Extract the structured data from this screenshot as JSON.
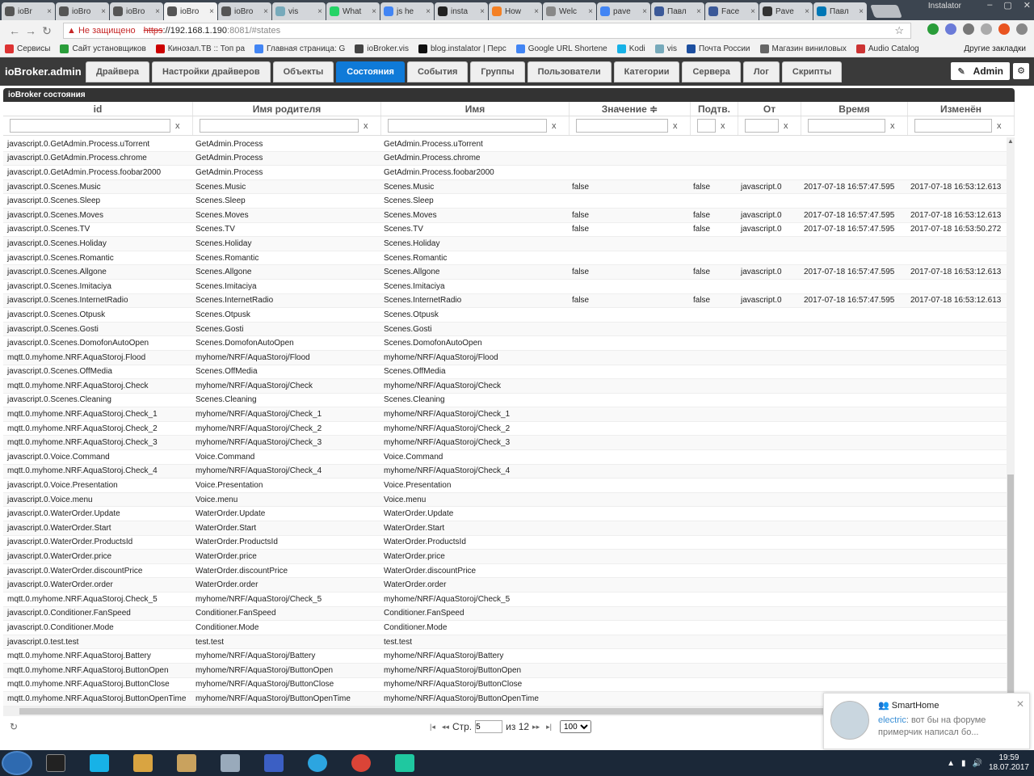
{
  "browser": {
    "tabs": [
      {
        "label": "ioBr",
        "color": "#555"
      },
      {
        "label": "ioBro",
        "color": "#555"
      },
      {
        "label": "ioBro",
        "color": "#555"
      },
      {
        "label": "ioBro",
        "color": "#555"
      },
      {
        "label": "ioBro",
        "color": "#555"
      },
      {
        "label": "vis",
        "color": "#7ab"
      },
      {
        "label": "What",
        "color": "#25d366"
      },
      {
        "label": "js he",
        "color": "#4285f4"
      },
      {
        "label": "insta",
        "color": "#222"
      },
      {
        "label": "How",
        "color": "#f48024"
      },
      {
        "label": "Welc",
        "color": "#888"
      },
      {
        "label": "pave",
        "color": "#4285f4"
      },
      {
        "label": "Павл",
        "color": "#3b5998"
      },
      {
        "label": "Face",
        "color": "#3b5998"
      },
      {
        "label": "Pave",
        "color": "#333"
      },
      {
        "label": "Павл",
        "color": "#0077b5"
      }
    ],
    "user": "Instalator",
    "insecure_label": "Не защищено",
    "url_scheme": "https",
    "url_host": "://192.168.1.190",
    "url_rest": ":8081/#states",
    "bookmarks": [
      "Сервисы",
      "Сайт установщиков",
      "Кинозал.ТВ :: Топ ра",
      "Главная страница: G",
      "ioBroker.vis",
      "blog.instalator | Перс",
      "Google URL Shortene",
      "Kodi",
      "vis",
      "Почта России",
      "Магазин виниловых",
      "Audio Catalog"
    ],
    "other_bookmarks": "Другие закладки"
  },
  "app": {
    "brand": "ioBroker.admin",
    "tabs": [
      "Драйвера",
      "Настройки драйверов",
      "Объекты",
      "Состояния",
      "События",
      "Группы",
      "Пользователи",
      "Категории",
      "Сервера",
      "Лог",
      "Скрипты"
    ],
    "active_tab": "Состояния",
    "user": "Admin",
    "accent": "#0f7ad8"
  },
  "grid": {
    "caption": "ioBroker состояния",
    "columns": [
      "id",
      "Имя родителя",
      "Имя",
      "Значение ≑",
      "Подтв.",
      "От",
      "Время",
      "Изменён"
    ],
    "filter_clear": "x",
    "rows": [
      [
        "javascript.0.GetAdmin.Process.uTorrent",
        "GetAdmin.Process",
        "GetAdmin.Process.uTorrent",
        "",
        "",
        "",
        "",
        ""
      ],
      [
        "javascript.0.GetAdmin.Process.chrome",
        "GetAdmin.Process",
        "GetAdmin.Process.chrome",
        "",
        "",
        "",
        "",
        ""
      ],
      [
        "javascript.0.GetAdmin.Process.foobar2000",
        "GetAdmin.Process",
        "GetAdmin.Process.foobar2000",
        "",
        "",
        "",
        "",
        ""
      ],
      [
        "javascript.0.Scenes.Music",
        "Scenes.Music",
        "Scenes.Music",
        "false",
        "false",
        "javascript.0",
        "2017-07-18 16:57:47.595",
        "2017-07-18 16:53:12.613"
      ],
      [
        "javascript.0.Scenes.Sleep",
        "Scenes.Sleep",
        "Scenes.Sleep",
        "",
        "",
        "",
        "",
        ""
      ],
      [
        "javascript.0.Scenes.Moves",
        "Scenes.Moves",
        "Scenes.Moves",
        "false",
        "false",
        "javascript.0",
        "2017-07-18 16:57:47.595",
        "2017-07-18 16:53:12.613"
      ],
      [
        "javascript.0.Scenes.TV",
        "Scenes.TV",
        "Scenes.TV",
        "false",
        "false",
        "javascript.0",
        "2017-07-18 16:57:47.595",
        "2017-07-18 16:53:50.272"
      ],
      [
        "javascript.0.Scenes.Holiday",
        "Scenes.Holiday",
        "Scenes.Holiday",
        "",
        "",
        "",
        "",
        ""
      ],
      [
        "javascript.0.Scenes.Romantic",
        "Scenes.Romantic",
        "Scenes.Romantic",
        "",
        "",
        "",
        "",
        ""
      ],
      [
        "javascript.0.Scenes.Allgone",
        "Scenes.Allgone",
        "Scenes.Allgone",
        "false",
        "false",
        "javascript.0",
        "2017-07-18 16:57:47.595",
        "2017-07-18 16:53:12.613"
      ],
      [
        "javascript.0.Scenes.Imitaciya",
        "Scenes.Imitaciya",
        "Scenes.Imitaciya",
        "",
        "",
        "",
        "",
        ""
      ],
      [
        "javascript.0.Scenes.InternetRadio",
        "Scenes.InternetRadio",
        "Scenes.InternetRadio",
        "false",
        "false",
        "javascript.0",
        "2017-07-18 16:57:47.595",
        "2017-07-18 16:53:12.613"
      ],
      [
        "javascript.0.Scenes.Otpusk",
        "Scenes.Otpusk",
        "Scenes.Otpusk",
        "",
        "",
        "",
        "",
        ""
      ],
      [
        "javascript.0.Scenes.Gosti",
        "Scenes.Gosti",
        "Scenes.Gosti",
        "",
        "",
        "",
        "",
        ""
      ],
      [
        "javascript.0.Scenes.DomofonAutoOpen",
        "Scenes.DomofonAutoOpen",
        "Scenes.DomofonAutoOpen",
        "",
        "",
        "",
        "",
        ""
      ],
      [
        "mqtt.0.myhome.NRF.AquaStoroj.Flood",
        "myhome/NRF/AquaStoroj/Flood",
        "myhome/NRF/AquaStoroj/Flood",
        "",
        "",
        "",
        "",
        ""
      ],
      [
        "javascript.0.Scenes.OffMedia",
        "Scenes.OffMedia",
        "Scenes.OffMedia",
        "",
        "",
        "",
        "",
        ""
      ],
      [
        "mqtt.0.myhome.NRF.AquaStoroj.Check",
        "myhome/NRF/AquaStoroj/Check",
        "myhome/NRF/AquaStoroj/Check",
        "",
        "",
        "",
        "",
        ""
      ],
      [
        "javascript.0.Scenes.Cleaning",
        "Scenes.Cleaning",
        "Scenes.Cleaning",
        "",
        "",
        "",
        "",
        ""
      ],
      [
        "mqtt.0.myhome.NRF.AquaStoroj.Check_1",
        "myhome/NRF/AquaStoroj/Check_1",
        "myhome/NRF/AquaStoroj/Check_1",
        "",
        "",
        "",
        "",
        ""
      ],
      [
        "mqtt.0.myhome.NRF.AquaStoroj.Check_2",
        "myhome/NRF/AquaStoroj/Check_2",
        "myhome/NRF/AquaStoroj/Check_2",
        "",
        "",
        "",
        "",
        ""
      ],
      [
        "mqtt.0.myhome.NRF.AquaStoroj.Check_3",
        "myhome/NRF/AquaStoroj/Check_3",
        "myhome/NRF/AquaStoroj/Check_3",
        "",
        "",
        "",
        "",
        ""
      ],
      [
        "javascript.0.Voice.Command",
        "Voice.Command",
        "Voice.Command",
        "",
        "",
        "",
        "",
        ""
      ],
      [
        "mqtt.0.myhome.NRF.AquaStoroj.Check_4",
        "myhome/NRF/AquaStoroj/Check_4",
        "myhome/NRF/AquaStoroj/Check_4",
        "",
        "",
        "",
        "",
        ""
      ],
      [
        "javascript.0.Voice.Presentation",
        "Voice.Presentation",
        "Voice.Presentation",
        "",
        "",
        "",
        "",
        ""
      ],
      [
        "javascript.0.Voice.menu",
        "Voice.menu",
        "Voice.menu",
        "",
        "",
        "",
        "",
        ""
      ],
      [
        "javascript.0.WaterOrder.Update",
        "WaterOrder.Update",
        "WaterOrder.Update",
        "",
        "",
        "",
        "",
        ""
      ],
      [
        "javascript.0.WaterOrder.Start",
        "WaterOrder.Start",
        "WaterOrder.Start",
        "",
        "",
        "",
        "",
        ""
      ],
      [
        "javascript.0.WaterOrder.ProductsId",
        "WaterOrder.ProductsId",
        "WaterOrder.ProductsId",
        "",
        "",
        "",
        "",
        ""
      ],
      [
        "javascript.0.WaterOrder.price",
        "WaterOrder.price",
        "WaterOrder.price",
        "",
        "",
        "",
        "",
        ""
      ],
      [
        "javascript.0.WaterOrder.discountPrice",
        "WaterOrder.discountPrice",
        "WaterOrder.discountPrice",
        "",
        "",
        "",
        "",
        ""
      ],
      [
        "javascript.0.WaterOrder.order",
        "WaterOrder.order",
        "WaterOrder.order",
        "",
        "",
        "",
        "",
        ""
      ],
      [
        "mqtt.0.myhome.NRF.AquaStoroj.Check_5",
        "myhome/NRF/AquaStoroj/Check_5",
        "myhome/NRF/AquaStoroj/Check_5",
        "",
        "",
        "",
        "",
        ""
      ],
      [
        "javascript.0.Conditioner.FanSpeed",
        "Conditioner.FanSpeed",
        "Conditioner.FanSpeed",
        "",
        "",
        "",
        "",
        ""
      ],
      [
        "javascript.0.Conditioner.Mode",
        "Conditioner.Mode",
        "Conditioner.Mode",
        "",
        "",
        "",
        "",
        ""
      ],
      [
        "javascript.0.test.test",
        "test.test",
        "test.test",
        "",
        "",
        "",
        "",
        ""
      ],
      [
        "mqtt.0.myhome.NRF.AquaStoroj.Battery",
        "myhome/NRF/AquaStoroj/Battery",
        "myhome/NRF/AquaStoroj/Battery",
        "",
        "",
        "",
        "",
        ""
      ],
      [
        "mqtt.0.myhome.NRF.AquaStoroj.ButtonOpen",
        "myhome/NRF/AquaStoroj/ButtonOpen",
        "myhome/NRF/AquaStoroj/ButtonOpen",
        "",
        "",
        "",
        "",
        ""
      ],
      [
        "mqtt.0.myhome.NRF.AquaStoroj.ButtonClose",
        "myhome/NRF/AquaStoroj/ButtonClose",
        "myhome/NRF/AquaStoroj/ButtonClose",
        "",
        "",
        "",
        "",
        ""
      ],
      [
        "mqtt.0.myhome.NRF.AquaStoroj.ButtonOpenTime",
        "myhome/NRF/AquaStoroj/ButtonOpenTime",
        "myhome/NRF/AquaStoroj/ButtonOpenTime",
        "",
        "",
        "",
        "",
        ""
      ]
    ]
  },
  "pager": {
    "page_label": "Стр.",
    "page": "5",
    "of_label": "из",
    "total": "12",
    "page_size": "100"
  },
  "notification": {
    "group": "SmartHome",
    "sender": "electric",
    "text": ": вот бы на форуме примерчик написал бо..."
  },
  "taskbar": {
    "time": "19:59",
    "date": "18.07.2017"
  }
}
